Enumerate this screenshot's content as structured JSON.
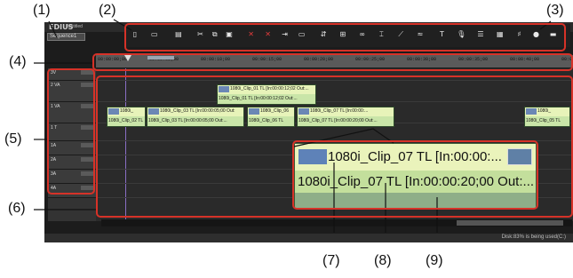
{
  "app": {
    "logo": "EDIUS",
    "project": "Untitled",
    "sequence_tab": "Sequence1"
  },
  "toolbar": {
    "buttons": [
      {
        "name": "new-icon",
        "glyph": "▯"
      },
      {
        "name": "open-icon",
        "glyph": "▭"
      },
      {
        "name": "save-icon",
        "glyph": "▤"
      },
      {
        "name": "cut-icon",
        "glyph": "✂"
      },
      {
        "name": "copy-icon",
        "glyph": "⧉"
      },
      {
        "name": "paste-icon",
        "glyph": "▣"
      },
      {
        "name": "delete-icon",
        "glyph": "✕",
        "red": true
      },
      {
        "name": "ripple-delete-icon",
        "glyph": "✕",
        "red": true
      },
      {
        "name": "insert-icon",
        "glyph": "⇥"
      },
      {
        "name": "overwrite-icon",
        "glyph": "▭"
      },
      {
        "name": "sync-icon",
        "glyph": "⇵"
      },
      {
        "name": "group-icon",
        "glyph": "⊞"
      },
      {
        "name": "link-icon",
        "glyph": "∞"
      },
      {
        "name": "snap-icon",
        "glyph": "⌶"
      },
      {
        "name": "marker-icon",
        "glyph": "⟋"
      },
      {
        "name": "waveform-icon",
        "glyph": "≈"
      },
      {
        "name": "title-icon",
        "glyph": "T"
      },
      {
        "name": "voice-icon",
        "glyph": "🎙"
      },
      {
        "name": "keyframe-icon",
        "glyph": "☰"
      },
      {
        "name": "grid-icon",
        "glyph": "▦"
      },
      {
        "name": "mixer-icon",
        "glyph": "♯"
      },
      {
        "name": "record-icon",
        "glyph": "●"
      },
      {
        "name": "menu-icon",
        "glyph": "▬"
      }
    ]
  },
  "ruler": {
    "ticks": [
      "00:00:00;00",
      "00:00:05;00",
      "00:00:10;00",
      "00:00:15;00",
      "00:00:20;00",
      "00:00:25;00",
      "00:00:30;00",
      "00:00:35;00",
      "00:00:40;00",
      "00:00:45;0"
    ]
  },
  "tracks": [
    {
      "label": "3V"
    },
    {
      "label": "2 VA"
    },
    {
      "label": "1 VA"
    },
    {
      "label": "1 T"
    },
    {
      "label": "1A"
    },
    {
      "label": "2A"
    },
    {
      "label": "3A"
    },
    {
      "label": "4A"
    }
  ],
  "clips": [
    {
      "title": "1080i_Clip_01  TL  [In:00:00:12;02 Out:...",
      "sub": "1080i_Clip_01  TL  [In:00:00:12;02 Out:..."
    },
    {
      "title": "1080i_",
      "sub": "1080i_Clip_02  TL"
    },
    {
      "title": "1080i_Clip_03  TL  [In:00:00:05;00 Out:",
      "sub": "1080i_Clip_03  TL  [In:00:00:05;00 Out:..."
    },
    {
      "title": "1080i_Clip_06",
      "sub": "1080i_Clip_06  TL"
    },
    {
      "title": "1080i_Clip_07  TL  [In:00:00:...",
      "sub": "1080i_Clip_07  TL  [In:00:00:20;00 Out:..."
    },
    {
      "title": "1080i_",
      "sub": "1080i_Clip_05  TL"
    }
  ],
  "zoom_clip": {
    "title": "1080i_Clip_07  TL  [In:00:00:...",
    "subtitle": "1080i_Clip_07  TL  [In:00:00:20;00 Out:..."
  },
  "status": "Disk:83% is being used(C:)",
  "callouts": [
    "(1)",
    "(2)",
    "(3)",
    "(4)",
    "(5)",
    "(6)",
    "(7)",
    "(8)",
    "(9)"
  ],
  "colors": {
    "callout_border": "#d63228",
    "clip_title_bg": "#eaf3bb",
    "clip_body_bg": "#c3df9c"
  }
}
